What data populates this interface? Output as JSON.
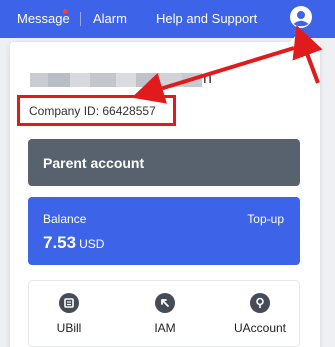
{
  "topbar": {
    "message": "Message",
    "alarm": "Alarm",
    "help": "Help and Support"
  },
  "account": {
    "name_tail": "n",
    "company_id": "Company ID: 66428557"
  },
  "parent_account": "Parent account",
  "balance": {
    "label": "Balance",
    "topup": "Top-up",
    "value": "7.53",
    "unit": "USD"
  },
  "shortcuts": [
    {
      "label": "UBill",
      "icon": "ubill-icon"
    },
    {
      "label": "IAM",
      "icon": "iam-icon"
    },
    {
      "label": "UAccount",
      "icon": "uaccount-icon"
    }
  ],
  "colors": {
    "brand": "#3d63e8",
    "parent_card": "#58616e",
    "annotation": "#e11b1b"
  }
}
